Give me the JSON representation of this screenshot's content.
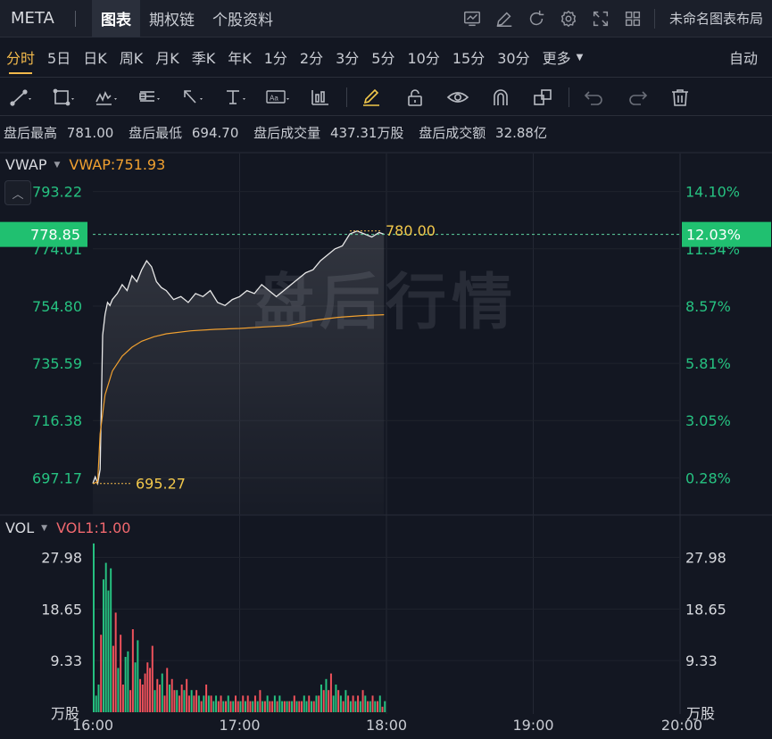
{
  "header": {
    "ticker": "META",
    "tabs": [
      "图表",
      "期权链",
      "个股资料"
    ],
    "active_tab": 0,
    "layout_name": "未命名图表布局",
    "icons": [
      "chart-template-icon",
      "edit-icon",
      "refresh-icon",
      "settings-icon",
      "fullscreen-icon",
      "layout-grid-icon"
    ]
  },
  "intervals": {
    "items": [
      "分时",
      "5日",
      "日K",
      "周K",
      "月K",
      "季K",
      "年K",
      "1分",
      "2分",
      "3分",
      "5分",
      "10分",
      "15分",
      "30分",
      "更多"
    ],
    "active": 0,
    "auto_label": "自动"
  },
  "draw_tools": [
    "trend-line-icon",
    "rectangle-icon",
    "pattern-icon",
    "fibonacci-icon",
    "arrow-icon",
    "text-icon",
    "annotation-icon",
    "measure-icon",
    "highlighter-icon",
    "lock-icon",
    "visibility-icon",
    "magnet-icon",
    "group-icon",
    "undo-icon",
    "redo-icon",
    "trash-icon"
  ],
  "summary": {
    "items": [
      {
        "label": "盘后最高",
        "value": "781.00"
      },
      {
        "label": "盘后最低",
        "value": "694.70"
      },
      {
        "label": "盘后成交量",
        "value": "437.31万股"
      },
      {
        "label": "盘后成交额",
        "value": "32.88亿"
      }
    ]
  },
  "price_panel": {
    "indicator": "VWAP",
    "indicator_value": "VWAP:751.93",
    "watermark": "盘后行情",
    "current_price": "778.85",
    "current_pct": "12.03%",
    "high_label": "780.00",
    "low_label": "695.27"
  },
  "vol_panel": {
    "indicator": "VOL",
    "indicator_value": "VOL1:1.00",
    "unit": "万股"
  },
  "colors": {
    "up": "#26c281",
    "down": "#f0525b",
    "price_line": "#e8e8e8",
    "vwap_line": "#f0a030",
    "accent": "#f2b94b",
    "highlight_bg": "#20c070"
  },
  "chart_data": [
    {
      "type": "line",
      "name_hint": "price",
      "x_ticks": [
        "16:00",
        "17:00",
        "18:00",
        "19:00",
        "20:00"
      ],
      "xlim": [
        "16:00",
        "20:00"
      ],
      "y_ticks_left": [
        "793.22",
        "774.01",
        "754.80",
        "735.59",
        "716.38",
        "697.17"
      ],
      "y_ticks_right": [
        "14.10%",
        "11.34%",
        "8.57%",
        "5.81%",
        "3.05%",
        "0.28%"
      ],
      "y_tick_values": [
        793.22,
        774.01,
        754.8,
        735.59,
        716.38,
        697.17
      ],
      "ylim": [
        685,
        806
      ],
      "series": [
        {
          "key": "price",
          "x": [
            "16:00",
            "16:01",
            "16:02",
            "16:03",
            "16:04",
            "16:05",
            "16:06",
            "16:07",
            "16:08",
            "16:10",
            "16:12",
            "16:14",
            "16:16",
            "16:18",
            "16:20",
            "16:22",
            "16:24",
            "16:26",
            "16:28",
            "16:30",
            "16:33",
            "16:36",
            "16:39",
            "16:42",
            "16:45",
            "16:48",
            "16:51",
            "16:54",
            "16:57",
            "17:00",
            "17:03",
            "17:06",
            "17:09",
            "17:12",
            "17:15",
            "17:18",
            "17:21",
            "17:24",
            "17:27",
            "17:30",
            "17:33",
            "17:36",
            "17:39",
            "17:42",
            "17:45",
            "17:48",
            "17:51",
            "17:54",
            "17:57",
            "17:59"
          ],
          "values": [
            695.3,
            697.5,
            695.3,
            700,
            745,
            752,
            756,
            755,
            757,
            759,
            762,
            760,
            765,
            763,
            767,
            770,
            768,
            763,
            761,
            760,
            757,
            758,
            756,
            759,
            758,
            760,
            756,
            755,
            757,
            758,
            760,
            759,
            762,
            760,
            758,
            760,
            762,
            764,
            766,
            767,
            770,
            772,
            774,
            775,
            779,
            780,
            779,
            778,
            779.5,
            778.9
          ]
        },
        {
          "key": "vwap",
          "x": [
            "16:00",
            "16:01",
            "16:02",
            "16:03",
            "16:05",
            "16:08",
            "16:12",
            "16:16",
            "16:20",
            "16:25",
            "16:30",
            "16:40",
            "16:50",
            "17:00",
            "17:10",
            "17:20",
            "17:30",
            "17:40",
            "17:50",
            "17:59"
          ],
          "values": [
            695.3,
            695.5,
            696,
            712,
            725,
            733,
            738,
            741,
            743,
            744.5,
            745.5,
            746.5,
            747,
            747.3,
            747.8,
            748.3,
            750,
            751,
            751.6,
            751.9
          ]
        }
      ]
    },
    {
      "type": "bar",
      "name_hint": "volume",
      "y_ticks": [
        "27.98",
        "18.65",
        "9.33"
      ],
      "y_tick_values": [
        27.98,
        18.65,
        9.33
      ],
      "ylim": [
        0,
        30
      ],
      "unit": "万股",
      "values": [
        30.5,
        3,
        5,
        14,
        24,
        27,
        22,
        26,
        12,
        18,
        8,
        14,
        5,
        10,
        11,
        4,
        15,
        9,
        13,
        6,
        5,
        7,
        9,
        8,
        12,
        4,
        6,
        5,
        7,
        3,
        8,
        5,
        6,
        4,
        4,
        3,
        5,
        4,
        6,
        3,
        4,
        3,
        4,
        3,
        2,
        3,
        5,
        3,
        3,
        2,
        3,
        2,
        3,
        2,
        2,
        3,
        2,
        2,
        3,
        2,
        2,
        3,
        2,
        3,
        2,
        2,
        3,
        2,
        4,
        2,
        2,
        3,
        2,
        2,
        3,
        2,
        3,
        2,
        2,
        2,
        2,
        2,
        3,
        2,
        2,
        2,
        3,
        2,
        3,
        2,
        2,
        3,
        3,
        5,
        4,
        6,
        4,
        7,
        3,
        5,
        4,
        3,
        2,
        4,
        3,
        2,
        3,
        2,
        3,
        2,
        4,
        3,
        2,
        2,
        3,
        2,
        2,
        3,
        1,
        2
      ],
      "directions": "UUUDUUUUDDUDDUUDDUUDDDDDDUDDUDDUDDUDDUDDUDDUDUDUDUUDDUDUDUDDUDUDDUDUDUDUDDUDUUDUDUDUDDUUDUDUDUDUDDUUDUDUDUDUDUDUDUDUDUD"
    }
  ]
}
